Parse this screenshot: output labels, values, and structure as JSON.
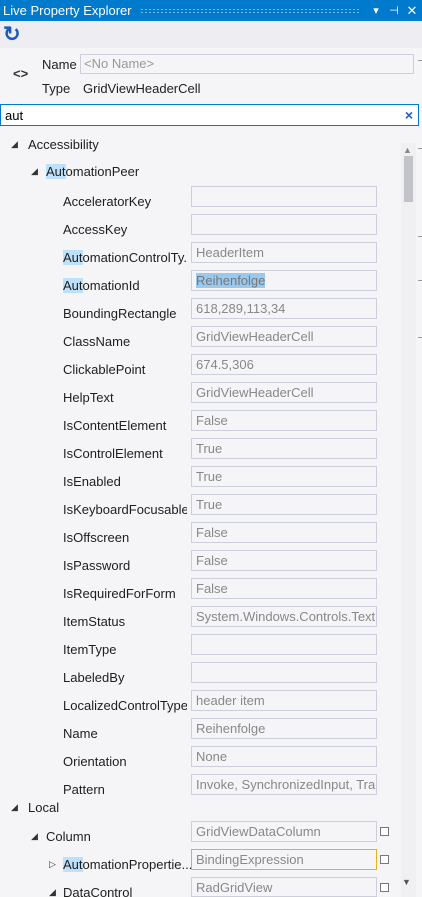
{
  "window": {
    "title": "Live Property Explorer",
    "dropdown_glyph": "▾",
    "pin_glyph": "⊣",
    "close_glyph": "✕"
  },
  "toolbar": {
    "refresh_glyph": "↻"
  },
  "element": {
    "icon_glyph": "<>",
    "name_label": "Name",
    "name_placeholder": "<No Name>",
    "type_label": "Type",
    "type_value": "GridViewHeaderCell"
  },
  "search": {
    "value": "aut",
    "clear_glyph": "×"
  },
  "tree": {
    "expanded_glyph": "◢",
    "collapsed_glyph": "▷",
    "accessibility": "Accessibility",
    "automation_peer_hl": "Aut",
    "automation_peer_rest": "omationPeer",
    "properties": [
      {
        "pre": "",
        "hl": "",
        "post": "AcceleratorKey",
        "value": ""
      },
      {
        "pre": "",
        "hl": "",
        "post": "AccessKey",
        "value": ""
      },
      {
        "pre": "",
        "hl": "Aut",
        "post": "omationControlTy...",
        "value": "HeaderItem"
      },
      {
        "pre": "",
        "hl": "Aut",
        "post": "omationId",
        "value": "Reihenfolge"
      },
      {
        "pre": "",
        "hl": "",
        "post": "BoundingRectangle",
        "value": "618,289,113,34"
      },
      {
        "pre": "",
        "hl": "",
        "post": "ClassName",
        "value": "GridViewHeaderCell"
      },
      {
        "pre": "",
        "hl": "",
        "post": "ClickablePoint",
        "value": "674.5,306"
      },
      {
        "pre": "",
        "hl": "",
        "post": "HelpText",
        "value": "GridViewHeaderCell"
      },
      {
        "pre": "",
        "hl": "",
        "post": "IsContentElement",
        "value": "False"
      },
      {
        "pre": "",
        "hl": "",
        "post": "IsControlElement",
        "value": "True"
      },
      {
        "pre": "",
        "hl": "",
        "post": "IsEnabled",
        "value": "True"
      },
      {
        "pre": "",
        "hl": "",
        "post": "IsKeyboardFocusable",
        "value": "True"
      },
      {
        "pre": "",
        "hl": "",
        "post": "IsOffscreen",
        "value": "False"
      },
      {
        "pre": "",
        "hl": "",
        "post": "IsPassword",
        "value": "False"
      },
      {
        "pre": "",
        "hl": "",
        "post": "IsRequiredForForm",
        "value": "False"
      },
      {
        "pre": "",
        "hl": "",
        "post": "ItemStatus",
        "value": "System.Windows.Controls.TextBloc"
      },
      {
        "pre": "",
        "hl": "",
        "post": "ItemType",
        "value": ""
      },
      {
        "pre": "",
        "hl": "",
        "post": "LabeledBy",
        "value": ""
      },
      {
        "pre": "",
        "hl": "",
        "post": "LocalizedControlType",
        "value": "header item"
      },
      {
        "pre": "",
        "hl": "",
        "post": "Name",
        "value": "Reihenfolge"
      },
      {
        "pre": "",
        "hl": "",
        "post": "Orientation",
        "value": "None"
      },
      {
        "pre": "",
        "hl": "",
        "post": "Pattern",
        "value": "Invoke, SynchronizedInput, Transfo"
      }
    ],
    "local": "Local",
    "column": {
      "label": "Column",
      "value": "GridViewDataColumn"
    },
    "automation_properties": {
      "hl": "Aut",
      "post": "omationPropertie...",
      "value": "BindingExpression"
    },
    "data_control": {
      "label": "DataControl",
      "value": "RadGridView"
    }
  },
  "scrollbar": {
    "up_glyph": "▲",
    "down_glyph": "▼"
  }
}
